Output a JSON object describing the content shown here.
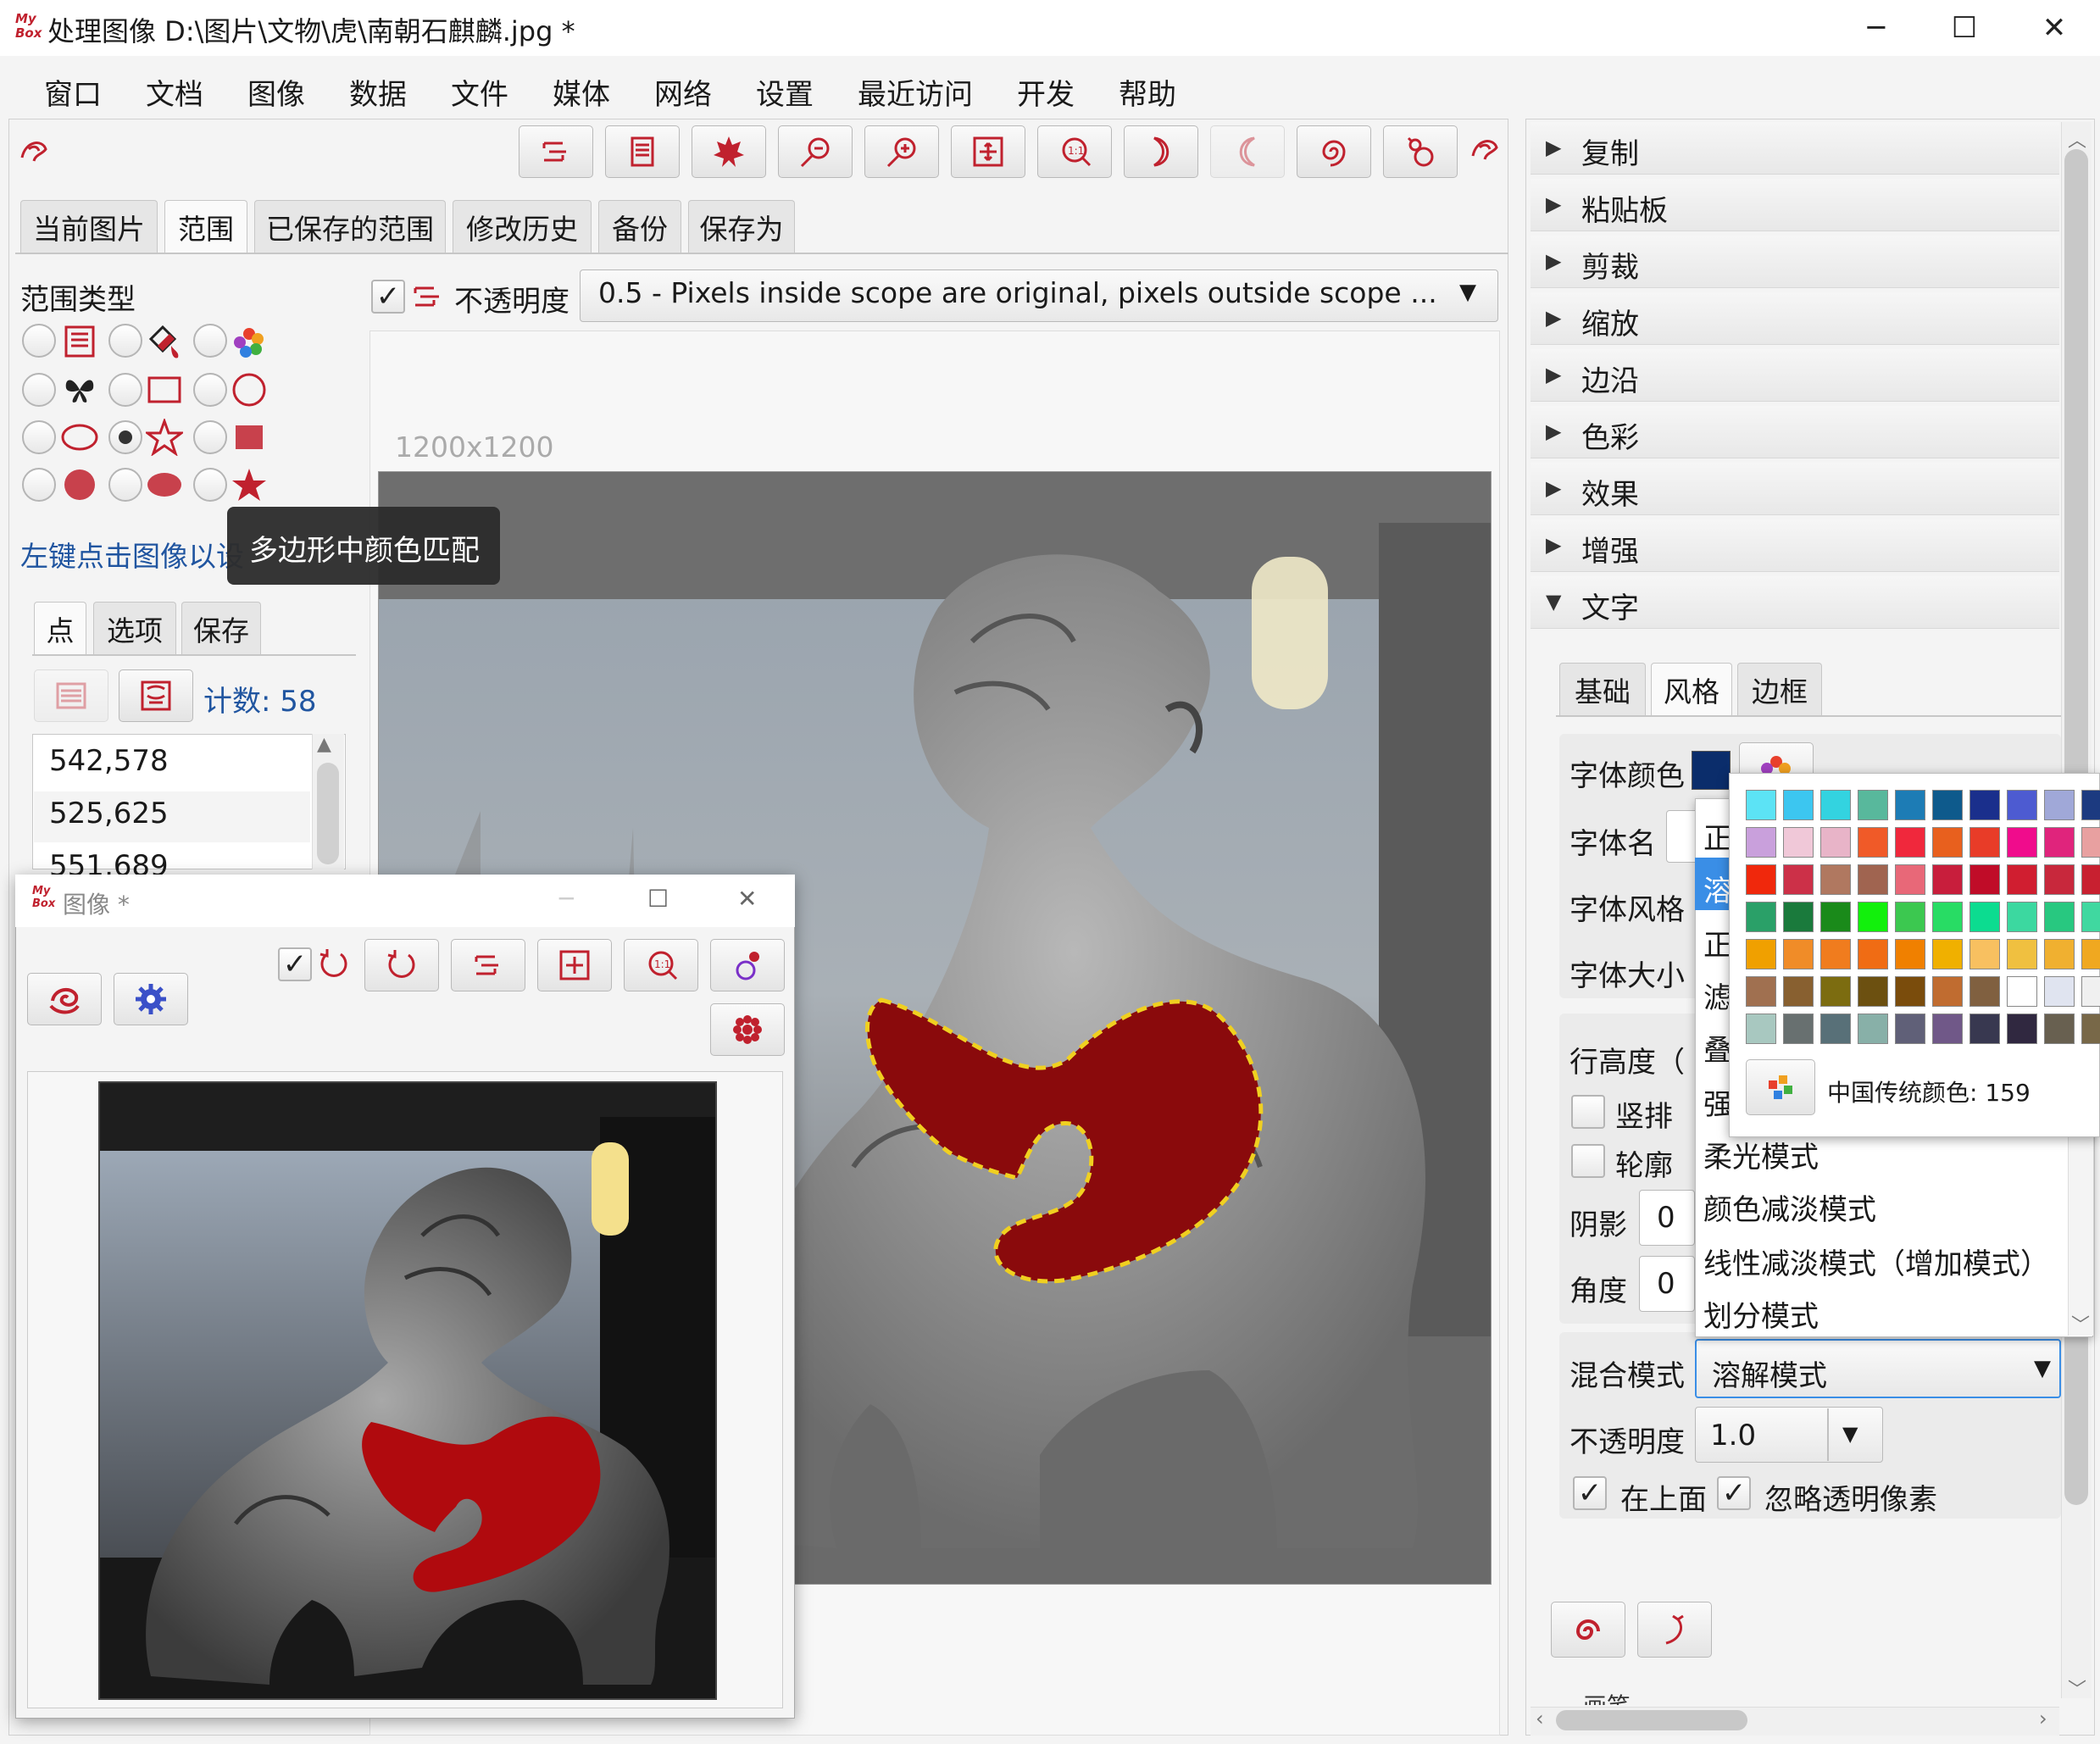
{
  "window": {
    "title": "处理图像 D:\\图片\\文物\\虎\\南朝石麒麟.jpg  *",
    "logo": "My Box",
    "minimize_icon": "─",
    "maximize_icon": "☐",
    "close_icon": "✕"
  },
  "menu": [
    "窗口",
    "文档",
    "图像",
    "数据",
    "文件",
    "媒体",
    "网络",
    "设置",
    "最近访问",
    "开发",
    "帮助"
  ],
  "main_tabs": [
    "当前图片",
    "范围",
    "已保存的范围",
    "修改历史",
    "备份",
    "保存为"
  ],
  "selected_main_tab": "范围",
  "scope": {
    "type_label": "范围类型",
    "hint": "左键点击图像以设",
    "tooltip": "多边形中颜色匹配",
    "selected_type": "polygon"
  },
  "opacity_bar": {
    "checked": true,
    "label": "不透明度",
    "value": "0.5 - Pixels inside scope are original, pixels outside scope ..."
  },
  "image_size": "1200x1200",
  "points_tabs": [
    "点",
    "选项",
    "保存"
  ],
  "count_label": "计数: 58",
  "points": [
    "542,578",
    "525,625",
    "551,689"
  ],
  "sub_window": {
    "logo": "My Box",
    "title": "图像  *",
    "min_icon": "─",
    "max_icon": "☐",
    "close_icon": "✕",
    "checked": true
  },
  "accordion": [
    "复制",
    "粘贴板",
    "剪裁",
    "缩放",
    "边沿",
    "色彩",
    "效果",
    "增强",
    "文字"
  ],
  "accordion_open": "文字",
  "bottom_cut_label": "画笔",
  "text_tabs": [
    "基础",
    "风格",
    "边框"
  ],
  "selected_text_tab": "风格",
  "style": {
    "font_color_label": "字体颜色",
    "font_name_label": "字体名",
    "font_style_label": "字体风格",
    "font_size_label": "字体大小",
    "line_height_label": "行高度（",
    "vertical_label": "竖排",
    "outline_label": "轮廓",
    "shadow_label": "阴影",
    "shadow_value": "0",
    "angle_label": "角度",
    "angle_value": "0",
    "blend_label": "混合模式",
    "blend_value": "溶解模式",
    "opacity_label": "不透明度",
    "opacity_value": "1.0",
    "on_top_label": "在上面",
    "ignore_transparent_label": "忽略透明像素",
    "font_color": "#0b2d6b"
  },
  "blend_list": {
    "partial": [
      "正",
      "溶",
      "正",
      "滤",
      "叠",
      "强"
    ],
    "items": [
      "柔光模式",
      "颜色减淡模式",
      "线性减淡模式（增加模式）",
      "划分模式"
    ]
  },
  "palette": {
    "label": "中国传统颜色: 159",
    "colors": [
      [
        "#5ce3f5",
        "#3cc6f0",
        "#33d3e0",
        "#58b89c",
        "#1d7cb5",
        "#0e5a8c",
        "#1a2f8c",
        "#4d5bd1",
        "#a0a8d8",
        "#1c3a80"
      ],
      [
        "#c9a0dc",
        "#f0c8d8",
        "#e8b4c8",
        "#f05a28",
        "#f0283c",
        "#e8601e",
        "#e83c28",
        "#f00c8c",
        "#e0247c",
        "#e8a0a0"
      ],
      [
        "#f0280c",
        "#cc3048",
        "#b07860",
        "#a06450",
        "#e86878",
        "#c81e3c",
        "#c00c28",
        "#d01e30",
        "#c8283c",
        "#c82030"
      ],
      [
        "#2aa068",
        "#1a7a3c",
        "#1a8a1a",
        "#12f00c",
        "#3cc850",
        "#28dc64",
        "#0cdc90",
        "#3cd8a0",
        "#28c880",
        "#40d8a0"
      ],
      [
        "#f0a000",
        "#f08c28",
        "#f07c1e",
        "#f06c14",
        "#f08000",
        "#f0b000",
        "#f8c060",
        "#f0c040",
        "#f0b030",
        "#f0a820"
      ],
      [
        "#a07050",
        "#886030",
        "#7c6c10",
        "#6c5010",
        "#7a4c0c",
        "#c06c30",
        "#806040",
        "#ffffff",
        "#e0e4f0",
        "#f0f0f0"
      ],
      [
        "#a8c8c0",
        "#687070",
        "#587078",
        "#88b0a8",
        "#606078",
        "#705888",
        "#383850",
        "#302840",
        "#686050",
        "#786848"
      ]
    ]
  },
  "colors": {
    "accent": "#c0212e",
    "selection": "#3a8ee6",
    "link": "#2055a0"
  }
}
